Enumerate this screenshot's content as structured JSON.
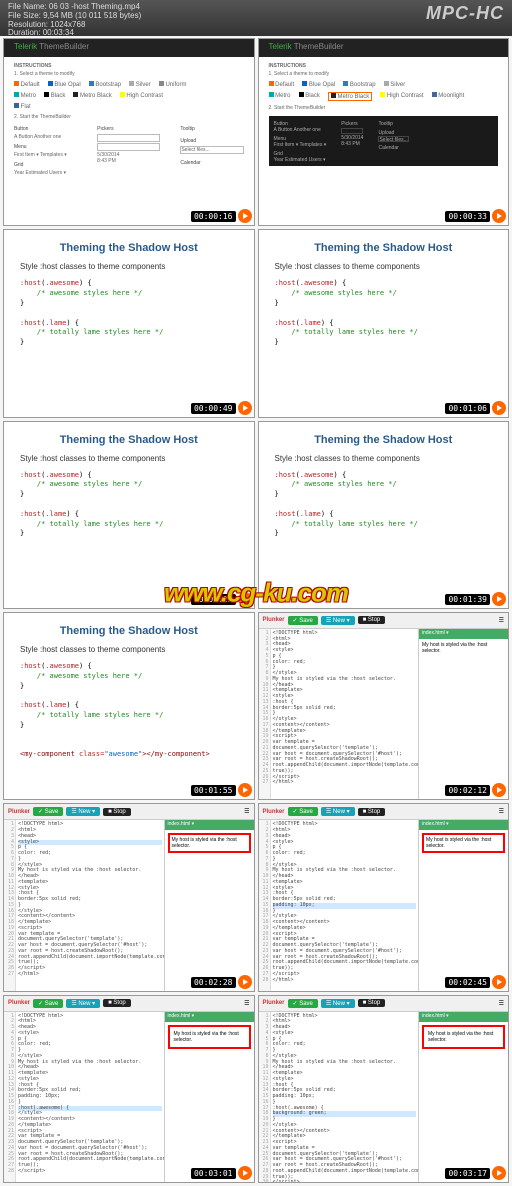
{
  "header": {
    "file_name_label": "File Name: ",
    "file_name": "06 03  -host Theming.mp4",
    "file_size_label": "File Size: ",
    "file_size": "9,54 MB (10 011 518 bytes)",
    "resolution_label": "Resolution: ",
    "resolution": "1024x768",
    "duration_label": "Duration: ",
    "duration": "00:03:34",
    "app": "MPC-HC"
  },
  "watermark": "www.cg-ku.com",
  "timestamps": [
    "00:00:16",
    "00:00:33",
    "00:00:49",
    "00:01:06",
    "00:01:22",
    "00:01:39",
    "00:01:55",
    "00:02:12",
    "00:02:28",
    "00:02:45",
    "00:03:01",
    "00:03:17"
  ],
  "telerik": {
    "brand": "Telerik",
    "product": "ThemeBuilder",
    "instructions_label": "INSTRUCTIONS",
    "instr1": "1. Select a theme to modify",
    "instr2": "2. Start the ThemeBuilder",
    "themes": [
      "Default",
      "Blue Opal",
      "Bootstrap",
      "Silver",
      "Uniform",
      "Metro",
      "Black",
      "Metro Black",
      "High Contrast",
      "Moonlight",
      "Flat"
    ],
    "start_btn": "Start the ThemeBuilder",
    "sections": {
      "button": "Button",
      "pickers": "Pickers",
      "tooltip": "Tooltip",
      "menu": "Menu",
      "upload": "Upload",
      "grid": "Grid",
      "calendar": "Calendar"
    },
    "button_text": "A Button   Another one",
    "menu_text": "First Item ▾   Templates ▾",
    "grid_text": "Year   Estimated Users ▾",
    "date": "5/30/2014",
    "time": "8:43 PM",
    "select_files": "Select files..."
  },
  "slide": {
    "title": "Theming the Shadow Host",
    "subtitle": "Style :host classes to theme components",
    "code1_sel": ":host",
    "code1_arg": ".awesome",
    "code1_comment": "/* awesome styles here */",
    "code2_sel": ":host",
    "code2_arg": ".lame",
    "code2_comment": "/* totally lame styles here */",
    "component_open": "<my-component ",
    "component_attr": "class=",
    "component_val": "\"awesome\"",
    "component_rest": "></my-component>"
  },
  "plunker": {
    "name": "Plunker",
    "save": "✓ Save",
    "new": "☰ New ▾",
    "stop": "■ Stop",
    "preview_label": "index.html ▾",
    "preview_text": "My host is styled via the :host selector.",
    "code_lines": [
      "<!DOCTYPE html>",
      "<html>",
      "  <head>",
      "    <style>",
      "      p {",
      "        color: red;",
      "      }",
      "    </style>",
      "    My host is styled via the :host selector.",
      "  </head>",
      "",
      "  <template>",
      "    <style>",
      "      :host {",
      "        border:5px solid red;",
      "      }",
      "    </style>",
      "    <content></content>",
      "  </template>",
      "",
      "  <script>",
      "    var template = document.querySelector('template');",
      "    var host = document.querySelector('#host');",
      "    var root = host.createShadowRoot();",
      "    root.appendChild(document.importNode(template.content, true));",
      "  </script>",
      "</html>"
    ],
    "variant_lines": {
      "padding": "        padding: 10px;",
      "host_awesome": "      :host(.awesome) {",
      "background": "        background: green;"
    }
  }
}
